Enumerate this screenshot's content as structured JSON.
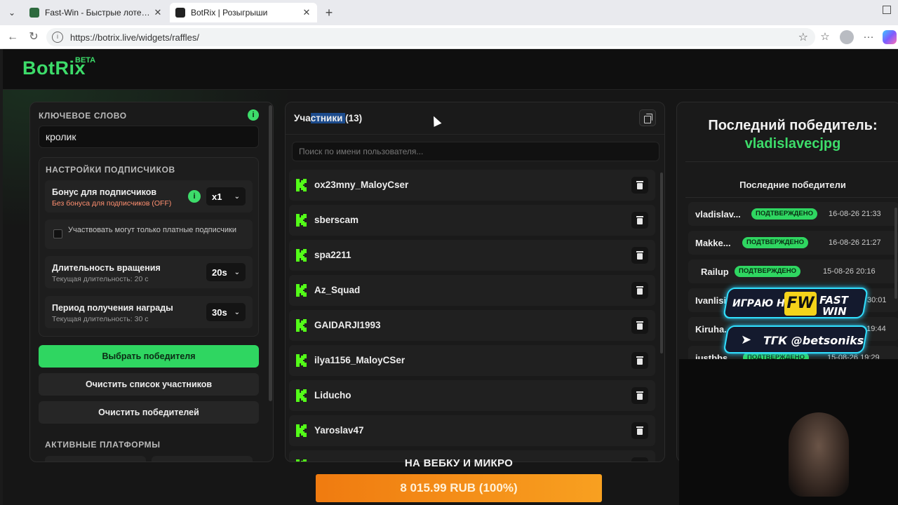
{
  "browser": {
    "tabs": [
      {
        "title": "Fast-Win - Быстрые лотереи! Ком"
      },
      {
        "title": "BotRix | Розыгрыши"
      }
    ],
    "url": "https://botrix.live/widgets/raffles/"
  },
  "app": {
    "logo": "BotRix",
    "beta": "BETA"
  },
  "left": {
    "keyword_title": "КЛЮЧЕВОЕ СЛОВО",
    "keyword_value": "кролик",
    "sub_settings_title": "НАСТРОЙКИ ПОДПИСЧИКОВ",
    "bonus_title": "Бонус для подписчиков",
    "bonus_sub": "Без бонуса для подписчиков (OFF)",
    "bonus_value": "x1",
    "paid_only_label": "Участвовать могут только платные подписчики",
    "spin_title": "Длительность вращения",
    "spin_sub": "Текущая длительность: 20 с",
    "spin_value": "20s",
    "claim_title": "Период получения награды",
    "claim_sub": "Текущая длительность: 30 с",
    "claim_value": "30s",
    "pick_winner": "Выбрать победителя",
    "clear_participants": "Очистить список участников",
    "clear_winners": "Очистить победителей",
    "platforms_title": "АКТИВНЫЕ ПЛАТФОРМЫ"
  },
  "middle": {
    "title_pre": "Уча",
    "title_hl": "стники ",
    "title_count": "(13)",
    "search_placeholder": "Поиск по имени пользователя...",
    "participants": [
      "ox23mny_MaloyCser",
      "sberscam",
      "spa2211",
      "Az_Squad",
      "GAIDARJI1993",
      "ilya1156_MaloyCSer",
      "Liducho",
      "Yaroslav47"
    ]
  },
  "right": {
    "last_winner_title": "Последний победитель:",
    "last_winner_name": "vladislavecjpg",
    "recent_title": "Последние победители",
    "winners": [
      {
        "name": "vladislav...",
        "status": "ПОДТВЕРЖДЕНО",
        "date": "16-08-26 21:33"
      },
      {
        "name": "Makke...",
        "status": "ПОДТВЕРЖДЕНО",
        "date": "16-08-26 21:27"
      },
      {
        "name": "Railup",
        "status": "ПОДТВЕРЖДЕНО",
        "date": "15-08-26 20:16"
      },
      {
        "name": "Ivanlisit",
        "status": "",
        "date": "30:01"
      },
      {
        "name": "Kiruha...",
        "status": "",
        "date": "5 19:44"
      },
      {
        "name": "justbbs",
        "status": "ПОДТВЕРЖДЕНО",
        "date": "15-08-26 19:29"
      }
    ]
  },
  "overlay": {
    "banner1_text": "ИГРАЮ НА",
    "banner1_logo": "FW",
    "banner1_brand1": "FAST",
    "banner1_brand2": "WIN",
    "banner2_text": "ТГК @betsoniks",
    "donate_title": "НА ВЕБКУ И МИКРО",
    "donate_amount": "8 015.99 RUB (100%)"
  },
  "colors": {
    "accent": "#3ddc6a",
    "donate": "#f39019",
    "banner": "#30e0ff"
  }
}
